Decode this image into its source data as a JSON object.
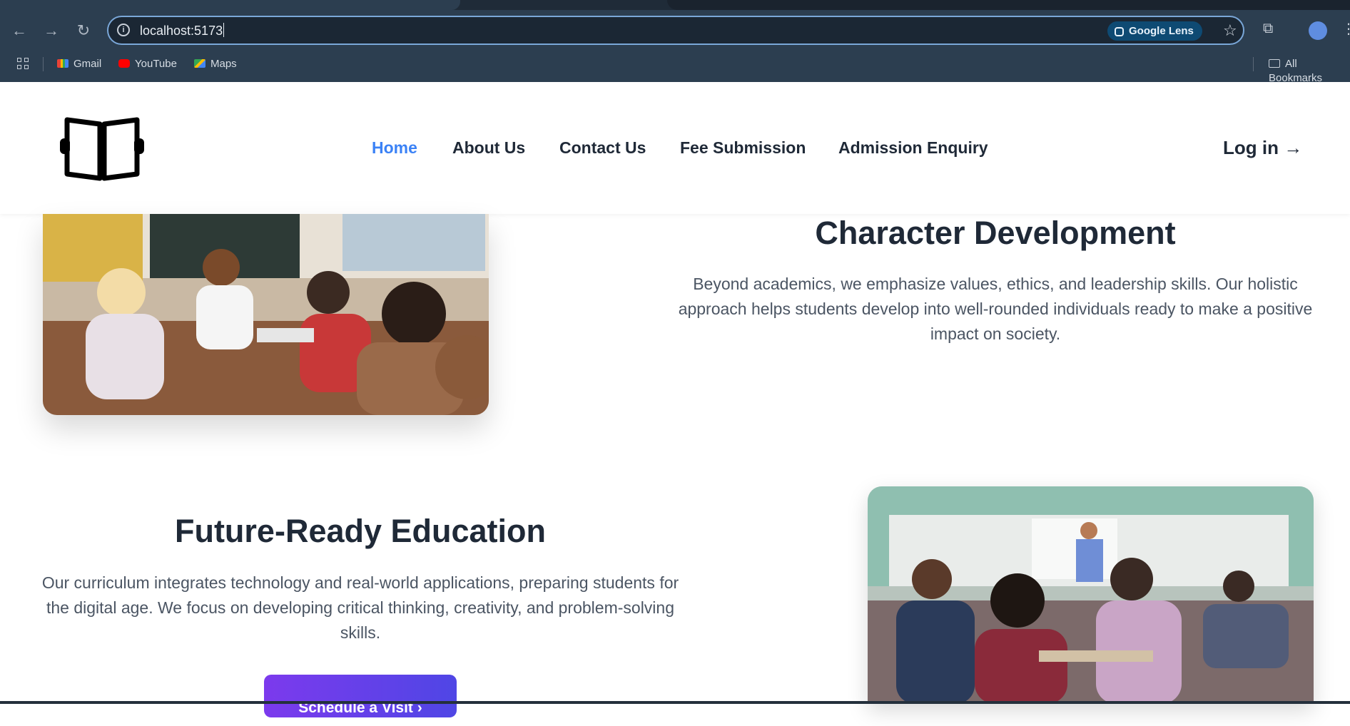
{
  "browser": {
    "url": "localhost:5173",
    "lens_label": "Google Lens",
    "bookmarks": [
      {
        "label": "Gmail",
        "icon": "gmail-icon"
      },
      {
        "label": "YouTube",
        "icon": "youtube-icon"
      },
      {
        "label": "Maps",
        "icon": "maps-icon"
      }
    ],
    "all_bookmarks": "All Bookmarks"
  },
  "header": {
    "nav": [
      "Home",
      "About Us",
      "Contact Us",
      "Fee Submission",
      "Admission Enquiry"
    ],
    "login": "Log in →"
  },
  "sections": {
    "character": {
      "title": "Character Development",
      "text": "Beyond academics, we emphasize values, ethics, and leadership skills. Our holistic approach helps students develop into well-rounded individuals ready to make a positive impact on society."
    },
    "future": {
      "title": "Future-Ready Education",
      "text": "Our curriculum integrates technology and real-world applications, preparing students for the digital age. We focus on developing critical thinking, creativity, and problem-solving skills.",
      "cta": "Schedule a Visit ›"
    }
  },
  "colors": {
    "accent": "#3b82f6",
    "cta_start": "#7c3aed",
    "cta_end": "#4f46e5",
    "chrome": "#2c3e50"
  }
}
